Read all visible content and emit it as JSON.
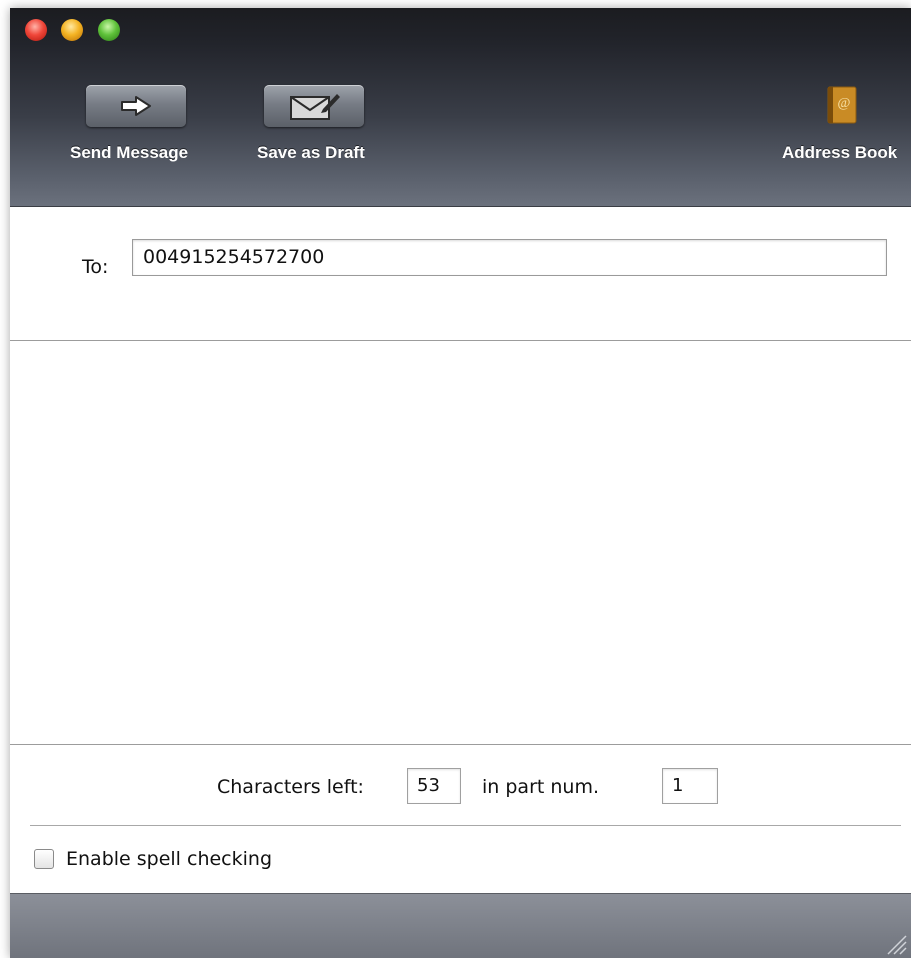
{
  "toolbar": {
    "send_label": "Send Message",
    "draft_label": "Save as Draft",
    "address_book_label": "Address Book",
    "send_icon": "arrow-right-icon",
    "draft_icon": "envelope-pen-icon",
    "address_book_icon": "address-book-icon"
  },
  "recipient": {
    "label": "To:",
    "value": "004915254572700"
  },
  "message": {
    "body": ""
  },
  "counter": {
    "chars_left_label": "Characters left:",
    "chars_left_value": "53",
    "part_label": "in part num.",
    "part_value": "1"
  },
  "options": {
    "spell_check_label": "Enable spell checking",
    "spell_check_checked": false
  },
  "colors": {
    "toolbar_top": "#1b1c20",
    "toolbar_bottom": "#6b717d",
    "close": "#f0473a",
    "minimize": "#f4b323",
    "zoom": "#5fc23a",
    "statusbar": "#7d8189"
  }
}
